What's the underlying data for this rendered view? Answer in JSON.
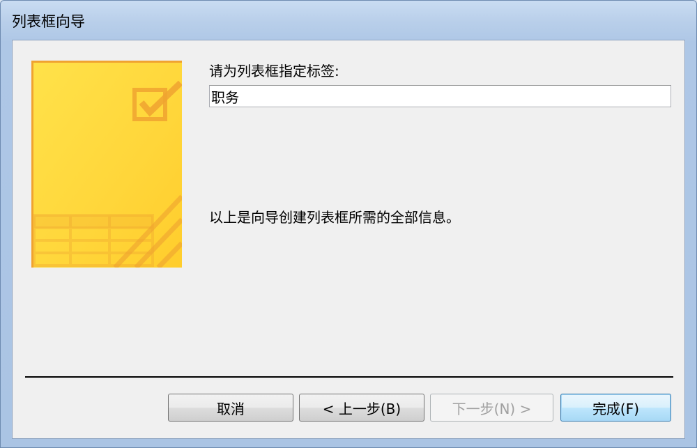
{
  "window": {
    "title": "列表框向导"
  },
  "prompt": {
    "label": "请为列表框指定标签:"
  },
  "label_field": {
    "value": "职务"
  },
  "info": {
    "text": "以上是向导创建列表框所需的全部信息。"
  },
  "buttons": {
    "cancel": "取消",
    "back": "< 上一步(B)",
    "next": "下一步(N) >",
    "finish": "完成(F)"
  },
  "colors": {
    "image_yellow": "#ffd63a",
    "image_orange": "#f0a330",
    "face": "#f0f0f0"
  },
  "icons": {
    "wizard_image": "checkbox-check-icon"
  }
}
